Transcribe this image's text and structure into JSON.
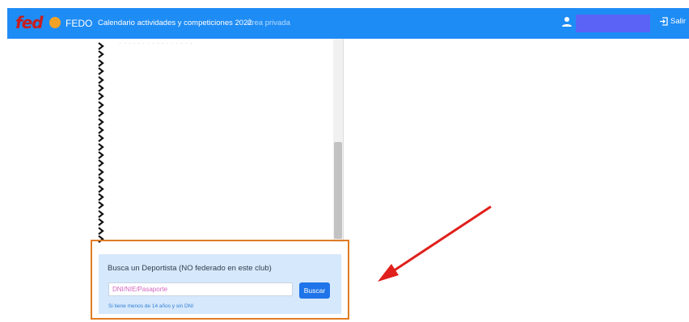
{
  "header": {
    "logo_text": "fed",
    "brand": "FEDO",
    "nav_calendar": "Calendario actividades y competiciones 2022",
    "nav_private": "Área privada",
    "logout": "Salir"
  },
  "list": {
    "faded_item": "· · · · · · · · · · · · · · · ·"
  },
  "search_panel": {
    "title": "Busca un Deportista (NO federado en este club)",
    "placeholder": "DNI/NIE/Pasaporte",
    "button": "Buscar",
    "minor_link": "Si tiene menos de 14 años y sin DNI"
  },
  "colors": {
    "header_bg": "#1e8cf5",
    "panel_bg": "#d6e8fb",
    "highlight_border": "#e07b22",
    "annotation_arrow": "#e0201c"
  }
}
